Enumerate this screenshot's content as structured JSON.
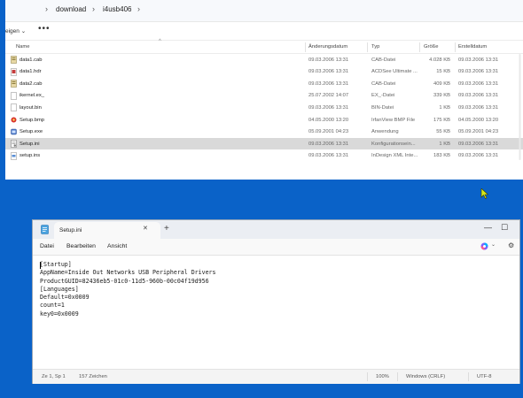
{
  "explorer": {
    "breadcrumb": [
      "download",
      "i4usb406"
    ],
    "toolbar": {
      "view_label": "eigen ⌄",
      "more_label": "•••"
    },
    "columns": {
      "name": "Name",
      "modified": "Änderungsdatum",
      "type": "Typ",
      "size": "Größe",
      "created": "Erstelldatum"
    },
    "files": [
      {
        "icon": "cab-file-icon",
        "name": "data1.cab",
        "modified": "09.03.2006 13:31",
        "type": "CAB-Datei",
        "size": "4.028 KB",
        "created": "09.03.2006 13:31"
      },
      {
        "icon": "acdsee-file-icon",
        "name": "data1.hdr",
        "modified": "09.03.2006 13:31",
        "type": "ACDSee Ultimate ...",
        "size": "15 KB",
        "created": "09.03.2006 13:31"
      },
      {
        "icon": "cab-file-icon",
        "name": "data2.cab",
        "modified": "09.03.2006 13:31",
        "type": "CAB-Datei",
        "size": "409 KB",
        "created": "09.03.2006 13:31"
      },
      {
        "icon": "generic-file-icon",
        "name": "ikernel.ex_",
        "modified": "25.07.2002 14:07",
        "type": "EX_-Datei",
        "size": "339 KB",
        "created": "09.03.2006 13:31"
      },
      {
        "icon": "generic-file-icon",
        "name": "layout.bin",
        "modified": "09.03.2006 13:31",
        "type": "BIN-Datei",
        "size": "1 KB",
        "created": "09.03.2006 13:31"
      },
      {
        "icon": "bmp-file-icon",
        "name": "Setup.bmp",
        "modified": "04.05.2000 13:20",
        "type": "IrfanView BMP File",
        "size": "175 KB",
        "created": "04.05.2000 13:20"
      },
      {
        "icon": "exe-file-icon",
        "name": "Setup.exe",
        "modified": "05.09.2001 04:23",
        "type": "Anwendung",
        "size": "55 KB",
        "created": "05.09.2001 04:23"
      },
      {
        "icon": "ini-file-icon",
        "name": "Setup.ini",
        "modified": "09.03.2006 13:31",
        "type": "Konfigurationsein...",
        "size": "1 KB",
        "created": "09.03.2006 13:31",
        "selected": true
      },
      {
        "icon": "xml-file-icon",
        "name": "setup.ins",
        "modified": "09.03.2006 13:31",
        "type": "InDesign XML Inte...",
        "size": "183 KB",
        "created": "09.03.2006 13:31"
      }
    ]
  },
  "notepad": {
    "tab_title": "Setup.ini",
    "tab_close": "✕",
    "new_tab": "+",
    "window_buttons": {
      "minimize": "—",
      "maximize": "☐"
    },
    "menu": [
      "Datei",
      "Bearbeiten",
      "Ansicht"
    ],
    "copilot_chevron": "⌄",
    "settings_icon_glyph": "⚙",
    "content": "[Startup]\nAppName=Inside Out Networks USB Peripheral Drivers\nProductGUID=82436eb5-01c0-11d5-960b-00c04f19d956\n[Languages]\nDefault=0x0009\ncount=1\nkey0=0x0009",
    "status": {
      "position": "Ze 1, Sp 1",
      "chars": "157 Zeichen",
      "zoom": "100%",
      "line_ending": "Windows (CRLF)",
      "encoding": "UTF-8"
    }
  }
}
